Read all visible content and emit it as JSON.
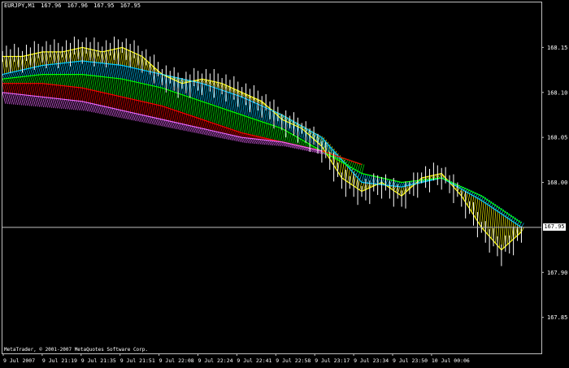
{
  "header": {
    "symbol": "EURJPY,M1",
    "open": "167.96",
    "high": "167.96",
    "low": "167.95",
    "close": "167.95"
  },
  "copyright": "MetaTrader, © 2001-2007 MetaQuotes Software Corp.",
  "current_price": "167.95",
  "colors": {
    "background": "#000000",
    "frame": "#c0c0c0",
    "text": "#ffffff",
    "bars": "#ffffff",
    "price_line": "#c0c0c0",
    "ribbon_yellow": "#ffff00",
    "ribbon_cyan": "#00c8ff",
    "ribbon_green": "#00ff00",
    "ribbon_red": "#ff0000",
    "ribbon_magenta": "#ee66ff"
  },
  "chart_data": {
    "type": "line",
    "title": "EURJPY,M1",
    "y_axis": {
      "ticks": [
        "168.15",
        "168.10",
        "168.05",
        "168.00",
        "167.95",
        "167.90",
        "167.85"
      ],
      "range": [
        167.81,
        168.2
      ],
      "side": "right"
    },
    "x_axis": {
      "ticks": [
        "9 Jul 2007",
        "9 Jul 21:19",
        "9 Jul 21:35",
        "9 Jul 21:51",
        "9 Jul 22:08",
        "9 Jul 22:24",
        "9 Jul 22:41",
        "9 Jul 22:58",
        "9 Jul 23:17",
        "9 Jul 23:34",
        "9 Jul 23:50",
        "10 Jul 00:06"
      ]
    },
    "grid": false,
    "series": [
      {
        "name": "",
        "color": "#ffff00",
        "x_index": [
          0,
          20,
          40,
          60,
          80,
          100,
          120,
          140,
          160,
          180,
          200,
          220,
          240,
          260,
          280,
          300,
          320,
          340,
          360,
          380,
          400,
          420,
          440,
          460,
          480,
          500,
          520
        ],
        "values": [
          168.14,
          168.14,
          168.145,
          168.145,
          168.15,
          168.145,
          168.15,
          168.14,
          168.12,
          168.11,
          168.115,
          168.11,
          168.1,
          168.09,
          168.07,
          168.06,
          168.04,
          168.005,
          167.99,
          168.0,
          167.985,
          168.005,
          168.01,
          167.985,
          167.95,
          167.925,
          167.945
        ]
      },
      {
        "name": "",
        "color": "#00c8ff",
        "x_index": [
          0,
          40,
          80,
          120,
          160,
          200,
          240,
          280,
          320,
          360,
          400,
          440,
          480,
          520
        ],
        "values": [
          168.12,
          168.13,
          168.135,
          168.13,
          168.12,
          168.11,
          168.095,
          168.075,
          168.05,
          168.0,
          167.995,
          168.005,
          167.98,
          167.95
        ]
      },
      {
        "name": "",
        "color": "#00ff00",
        "x_index": [
          0,
          40,
          80,
          120,
          160,
          200,
          240,
          280,
          320,
          360,
          400,
          440,
          480,
          520
        ],
        "values": [
          168.115,
          168.12,
          168.12,
          168.115,
          168.105,
          168.09,
          168.075,
          168.06,
          168.035,
          168.01,
          168.0,
          168.005,
          167.985,
          167.955
        ]
      },
      {
        "name": "",
        "color": "#ff0000",
        "x_index": [
          0,
          40,
          80,
          120,
          160,
          200,
          240,
          280,
          320,
          360
        ],
        "values": [
          168.11,
          168.11,
          168.105,
          168.095,
          168.085,
          168.07,
          168.055,
          168.045,
          168.035,
          168.02
        ]
      },
      {
        "name": "",
        "color": "#ee66ff",
        "x_index": [
          0,
          40,
          80,
          120,
          160,
          200,
          240,
          280,
          320
        ],
        "values": [
          168.1,
          168.095,
          168.09,
          168.08,
          168.07,
          168.06,
          168.05,
          168.045,
          168.035
        ]
      }
    ]
  }
}
